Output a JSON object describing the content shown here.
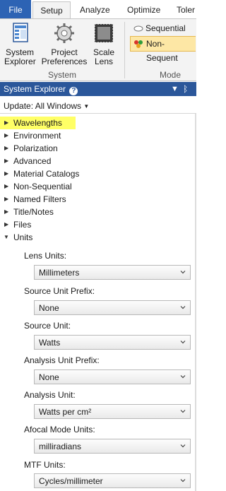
{
  "tabs": {
    "file": "File",
    "setup": "Setup",
    "analyze": "Analyze",
    "optimize": "Optimize",
    "tolerance": "Toler"
  },
  "ribbon": {
    "system_explorer": [
      "System",
      "Explorer"
    ],
    "project_preferences": [
      "Project",
      "Preferences"
    ],
    "scale_lens": [
      "Scale",
      "Lens"
    ],
    "system_group": "System",
    "mode_group": "Mode",
    "sequential": "Sequential",
    "non_sequential": "Non-Sequent"
  },
  "panel": {
    "title": "System Explorer",
    "help": "?",
    "update": "Update: All Windows"
  },
  "tree": [
    {
      "label": "Wavelengths",
      "expanded": false,
      "highlighted": true
    },
    {
      "label": "Environment",
      "expanded": false
    },
    {
      "label": "Polarization",
      "expanded": false
    },
    {
      "label": "Advanced",
      "expanded": false
    },
    {
      "label": "Material Catalogs",
      "expanded": false
    },
    {
      "label": "Non-Sequential",
      "expanded": false
    },
    {
      "label": "Named Filters",
      "expanded": false
    },
    {
      "label": "Title/Notes",
      "expanded": false
    },
    {
      "label": "Files",
      "expanded": false
    },
    {
      "label": "Units",
      "expanded": true
    }
  ],
  "units": {
    "lens_units_label": "Lens Units:",
    "lens_units": "Millimeters",
    "source_prefix_label": "Source Unit Prefix:",
    "source_prefix": "None",
    "source_unit_label": "Source Unit:",
    "source_unit": "Watts",
    "analysis_prefix_label": "Analysis Unit Prefix:",
    "analysis_prefix": "None",
    "analysis_unit_label": "Analysis Unit:",
    "analysis_unit": "Watts per cm²",
    "afocal_label": "Afocal Mode Units:",
    "afocal": "milliradians",
    "mtf_label": "MTF Units:",
    "mtf": "Cycles/millimeter"
  },
  "colors": {
    "accent": "#2b579a",
    "file_tab": "#2d63b4",
    "highlight": "#ffff66",
    "selected_mode": "#fde7a5"
  }
}
